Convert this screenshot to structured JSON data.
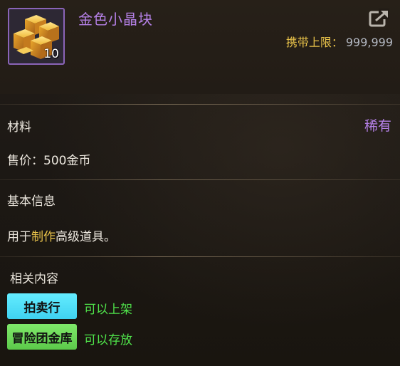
{
  "item": {
    "name": "金色小晶块",
    "count": "10",
    "icon": "gold-crystal-cubes-icon",
    "frame_color": "#8a64b8"
  },
  "header": {
    "carry_label": "携带上限：",
    "carry_value": "999,999",
    "share_icon": "share-icon"
  },
  "info": {
    "category": "材料",
    "rarity": "稀有",
    "price": "售价：500金币"
  },
  "basic": {
    "title": "基本信息",
    "desc_prefix": "用于",
    "desc_highlight": "制作",
    "desc_suffix": "高级道具。"
  },
  "related": {
    "title": "相关内容",
    "items": [
      {
        "button": "拍卖行",
        "status": "可以上架"
      },
      {
        "button": "冒险团金库",
        "status": "可以存放"
      }
    ]
  },
  "colors": {
    "rarity": "#b480e6",
    "highlight": "#e8c24a",
    "ok": "#4fe24a",
    "auction_button": "#4ee0f8",
    "storage_button": "#6ed95a"
  }
}
